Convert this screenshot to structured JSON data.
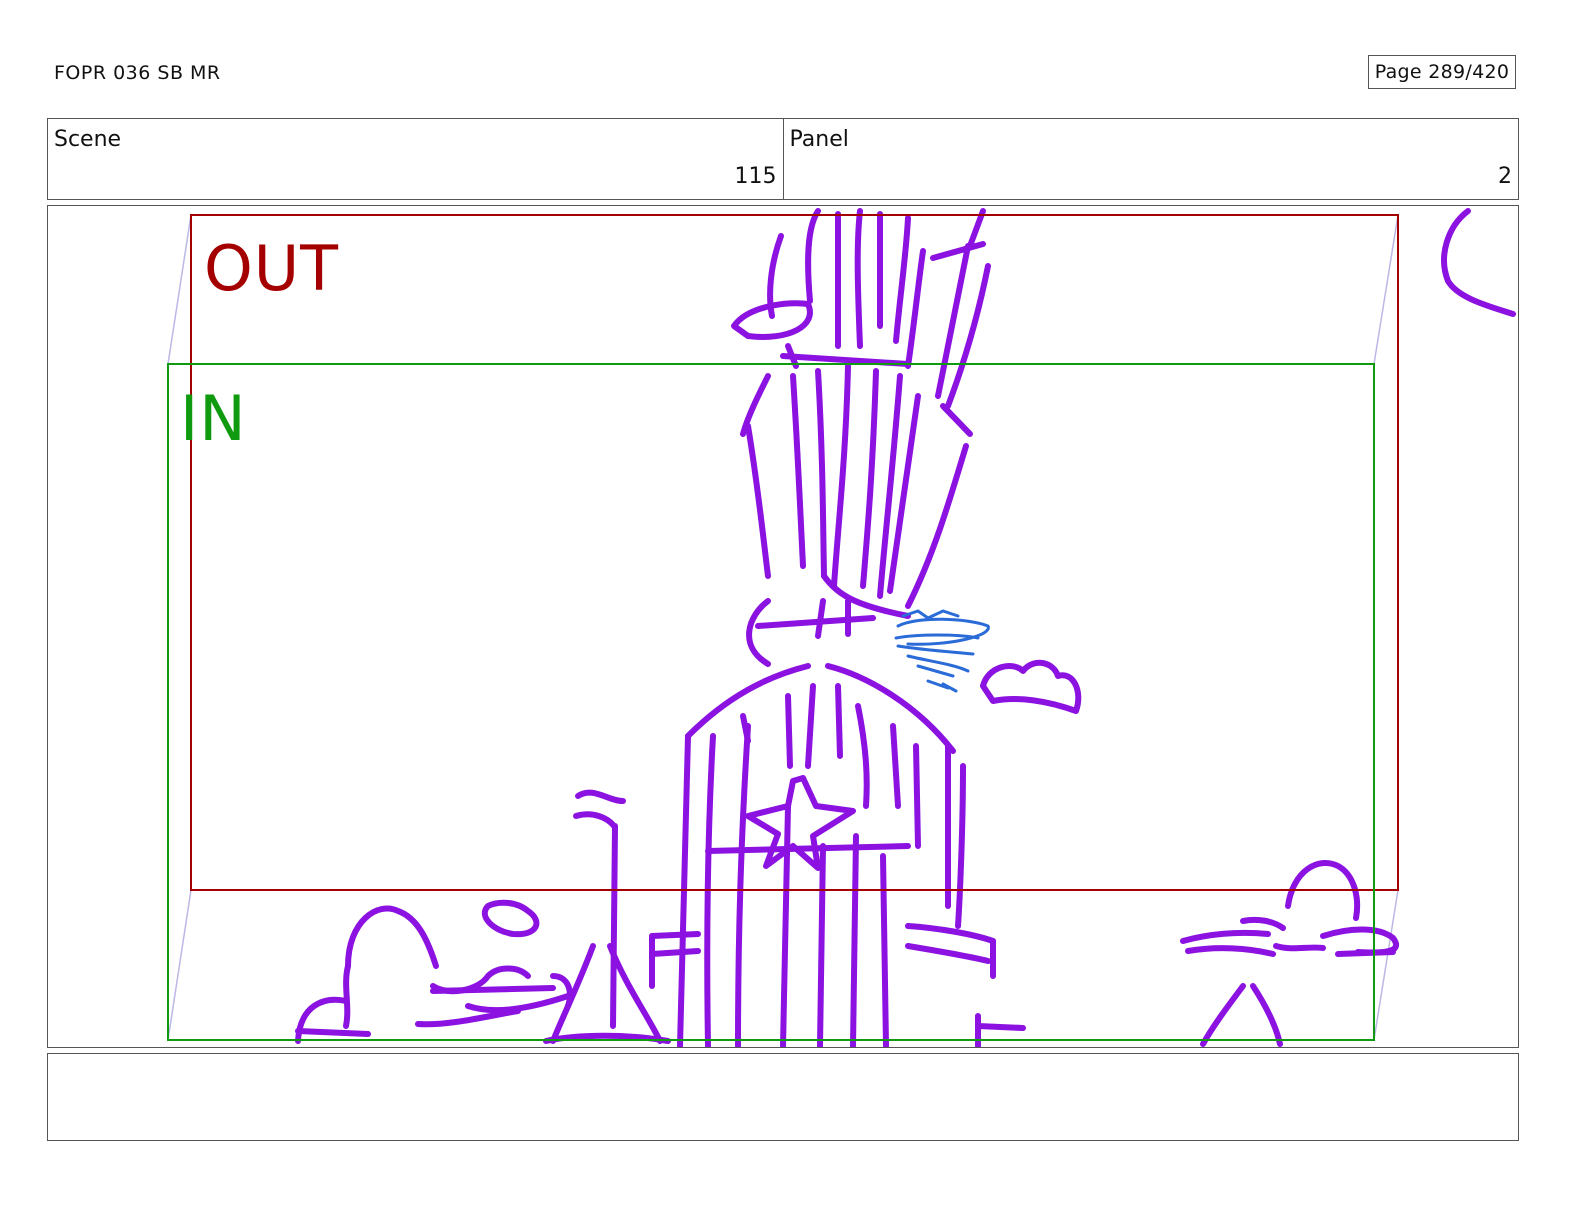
{
  "header": {
    "title": "FOPR 036 SB MR",
    "page": "Page 289/420"
  },
  "info": {
    "scene_label": "Scene",
    "scene_value": "115",
    "panel_label": "Panel",
    "panel_value": "2"
  },
  "frames": {
    "out_label": "OUT",
    "in_label": "IN",
    "out_color": "#a50000",
    "in_color": "#0f9a0f",
    "guide_color": "#bbb8e6"
  },
  "sketch": {
    "main_color": "#8b12e0",
    "accent_color": "#2a6bd8"
  },
  "notes": {
    "text": ""
  }
}
